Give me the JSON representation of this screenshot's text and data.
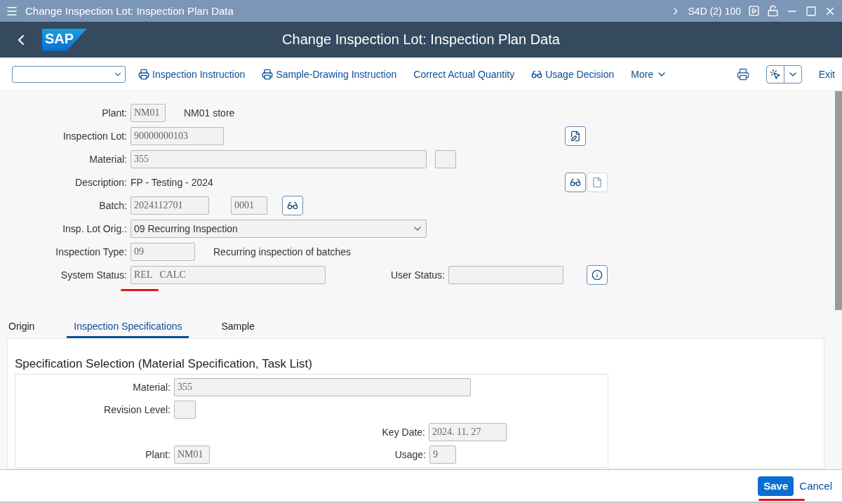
{
  "window": {
    "title": "Change Inspection Lot: Inspection Plan Data",
    "system": "S4D (2) 100"
  },
  "header": {
    "logo": "SAP",
    "title": "Change Inspection Lot: Inspection Plan Data"
  },
  "toolbar": {
    "actions": [
      {
        "label": "Inspection Instruction"
      },
      {
        "label": "Sample-Drawing Instruction"
      },
      {
        "label": "Correct Actual Quantity"
      },
      {
        "label": "Usage Decision"
      }
    ],
    "more": "More",
    "exit": "Exit"
  },
  "form": {
    "plant": {
      "label": "Plant:",
      "value": "NM01",
      "text": "NM01 store"
    },
    "inspection_lot": {
      "label": "Inspection Lot:",
      "value": "90000000103"
    },
    "material": {
      "label": "Material:",
      "value": "355"
    },
    "description": {
      "label": "Description:",
      "text": "FP - Testing - 2024"
    },
    "batch": {
      "label": "Batch:",
      "value": "2024112701",
      "value_2": "0001"
    },
    "lot_origin": {
      "label": "Insp. Lot Orig.:",
      "value": "09 Recurring Inspection"
    },
    "inspection_type": {
      "label": "Inspection Type:",
      "value": "09",
      "text": "Recurring inspection of batches"
    },
    "system_status": {
      "label": "System Status:",
      "value": "REL   CALC",
      "underlined": true
    },
    "user_status": {
      "label": "User Status:"
    }
  },
  "tabs": [
    {
      "label": "Origin",
      "selected": false
    },
    {
      "label": "Inspection Specifications",
      "selected": true
    },
    {
      "label": "Sample",
      "selected": false
    }
  ],
  "spec": {
    "title": "Specification Selection (Material Specification, Task List)",
    "material": {
      "label": "Material:",
      "value": "355"
    },
    "revision_level": {
      "label": "Revision Level:"
    },
    "key_date": {
      "label": "Key Date:",
      "value": "2024. 11. 27"
    },
    "plant": {
      "label": "Plant:",
      "value": "NM01"
    },
    "usage": {
      "label": "Usage:",
      "value": "9"
    }
  },
  "footer": {
    "save": {
      "label": "Save",
      "underlined": true
    },
    "cancel": "Cancel"
  }
}
